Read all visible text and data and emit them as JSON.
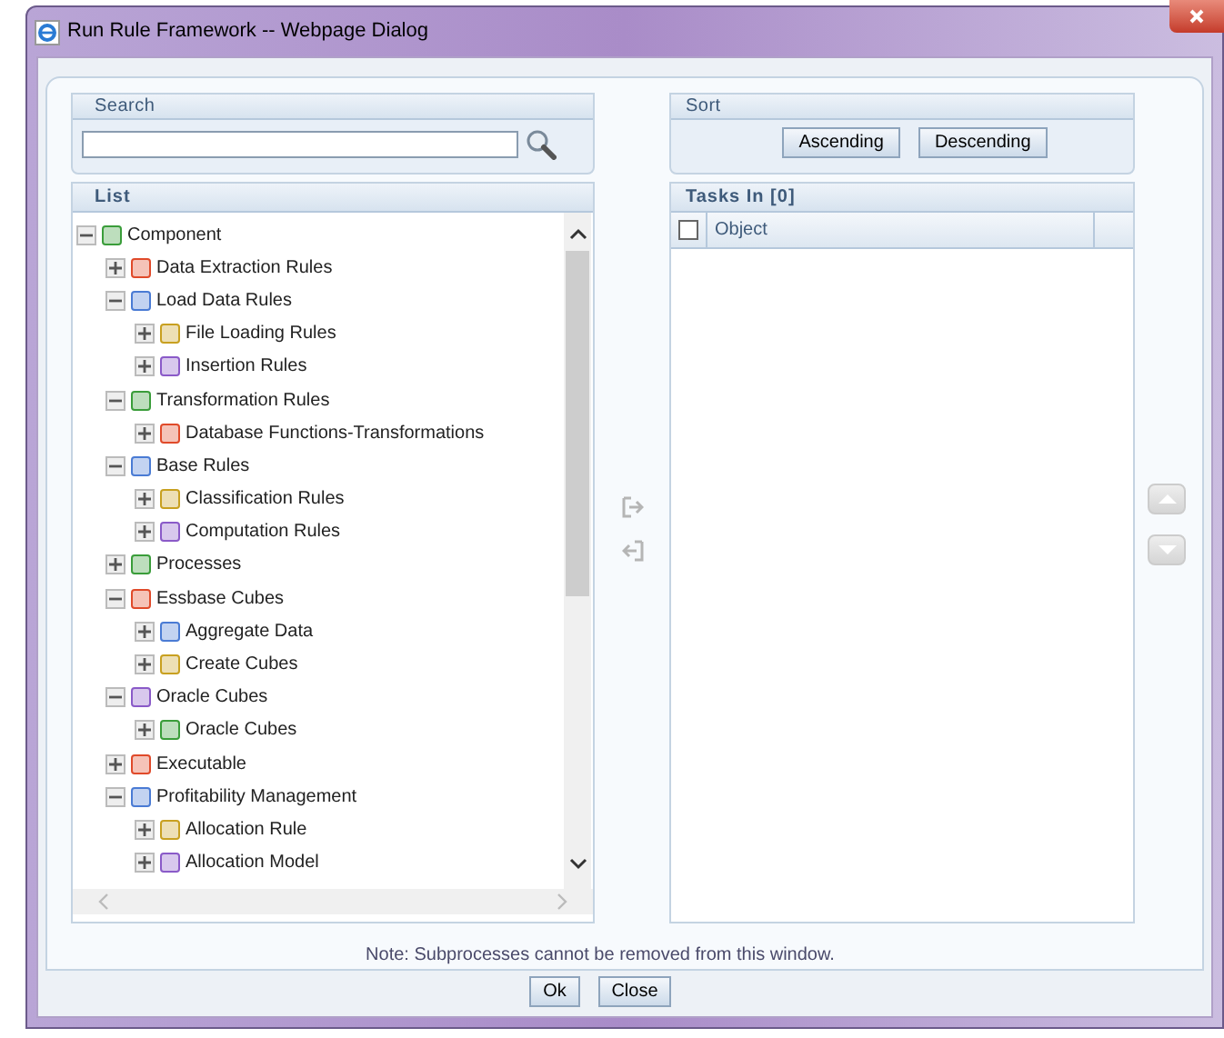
{
  "window": {
    "title": "Run Rule Framework -- Webpage Dialog"
  },
  "search": {
    "title": "Search"
  },
  "sort": {
    "title": "Sort",
    "buttons": [
      "Ascending",
      "Descending"
    ]
  },
  "list": {
    "title": "List",
    "tree": [
      {
        "label": "Component",
        "expanded": true,
        "children": [
          {
            "label": "Data Extraction Rules",
            "expanded": false
          },
          {
            "label": "Load Data Rules",
            "expanded": true,
            "children": [
              {
                "label": "File Loading Rules",
                "expanded": false
              },
              {
                "label": "Insertion Rules",
                "expanded": false
              }
            ]
          },
          {
            "label": "Transformation Rules",
            "expanded": true,
            "children": [
              {
                "label": "Database Functions-Transformations",
                "expanded": false
              }
            ]
          },
          {
            "label": "Base Rules",
            "expanded": true,
            "children": [
              {
                "label": "Classification Rules",
                "expanded": false
              },
              {
                "label": "Computation Rules",
                "expanded": false
              }
            ]
          },
          {
            "label": "Processes",
            "expanded": false
          },
          {
            "label": "Essbase Cubes",
            "expanded": true,
            "children": [
              {
                "label": "Aggregate Data",
                "expanded": false
              },
              {
                "label": "Create Cubes",
                "expanded": false
              }
            ]
          },
          {
            "label": "Oracle Cubes",
            "expanded": true,
            "children": [
              {
                "label": "Oracle Cubes",
                "expanded": false
              }
            ]
          },
          {
            "label": "Executable",
            "expanded": false
          },
          {
            "label": "Profitability Management",
            "expanded": true,
            "children": [
              {
                "label": "Allocation Rule",
                "expanded": false
              },
              {
                "label": "Allocation Model",
                "expanded": false
              }
            ]
          }
        ]
      }
    ]
  },
  "tasks": {
    "title": "Tasks In [0]",
    "columns": [
      "Object"
    ],
    "select_all_checked": false
  },
  "note": "Note: Subprocesses cannot be removed from this window.",
  "buttons": [
    "Ok",
    "Close"
  ]
}
